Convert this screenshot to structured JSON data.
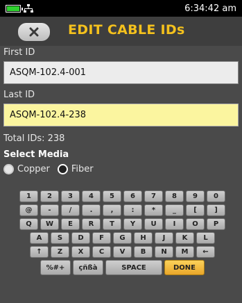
{
  "status": {
    "time": "6:34:42 am",
    "battery_level": 0.85,
    "battery_color": "#2fd12f"
  },
  "title": "EDIT CABLE IDs",
  "first_id": {
    "label": "First ID",
    "value": "ASQM-102.4-001"
  },
  "last_id": {
    "label": "Last ID",
    "value": "ASQM-102.4-238"
  },
  "total_ids": "Total IDs: 238",
  "select_media": {
    "label": "Select Media",
    "options": [
      {
        "label": "Copper",
        "selected": false
      },
      {
        "label": "Fiber",
        "selected": true
      }
    ]
  },
  "keyboard": {
    "row1": [
      "1",
      "2",
      "3",
      "4",
      "5",
      "6",
      "7",
      "8",
      "9",
      "0"
    ],
    "row2": [
      "@",
      "-",
      "/",
      ".",
      ",",
      ":",
      "*",
      "_",
      "[",
      "]"
    ],
    "row3": [
      "Q",
      "W",
      "E",
      "R",
      "T",
      "Y",
      "U",
      "I",
      "O",
      "P"
    ],
    "row4": [
      "A",
      "S",
      "D",
      "F",
      "G",
      "H",
      "J",
      "K",
      "L"
    ],
    "row5": [
      "↑",
      "Z",
      "X",
      "C",
      "V",
      "B",
      "N",
      "M",
      "←"
    ],
    "bottom": {
      "symbols": "%#+",
      "accents": "çñßà",
      "space": "SPACE",
      "done": "DONE"
    }
  },
  "colors": {
    "title": "#f4c11d",
    "active_field": "#fbf59f",
    "done_key": "#eaa72a"
  }
}
